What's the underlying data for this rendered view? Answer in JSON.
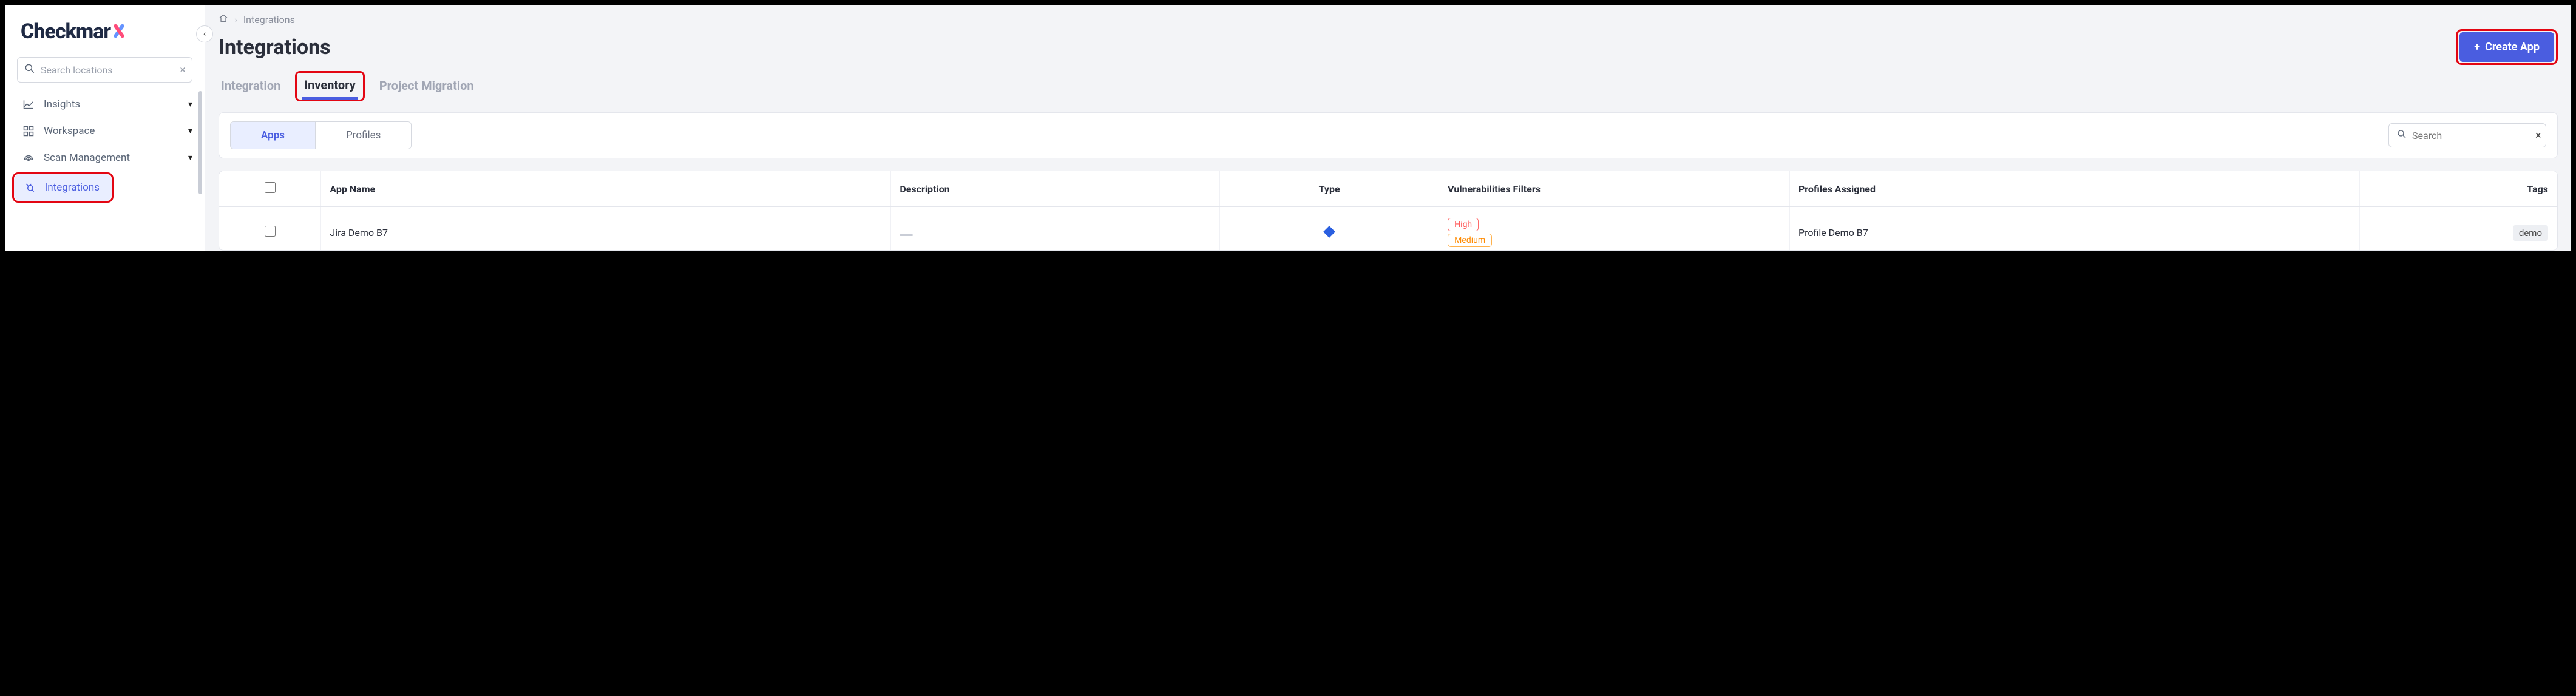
{
  "brand": {
    "name": "Checkmar"
  },
  "sidebar": {
    "search_placeholder": "Search locations",
    "items": [
      {
        "label": "Insights",
        "icon": "chart-line-icon",
        "expandable": true
      },
      {
        "label": "Workspace",
        "icon": "grid-icon",
        "expandable": true
      },
      {
        "label": "Scan Management",
        "icon": "radar-icon",
        "expandable": true
      },
      {
        "label": "Integrations",
        "icon": "plug-icon",
        "expandable": false,
        "active": true
      }
    ]
  },
  "breadcrumb": {
    "current": "Integrations"
  },
  "page": {
    "title": "Integrations",
    "create_label": "Create App"
  },
  "tabs": [
    {
      "label": "Integration",
      "active": false
    },
    {
      "label": "Inventory",
      "active": true
    },
    {
      "label": "Project Migration",
      "active": false
    }
  ],
  "subtabs": [
    {
      "label": "Apps",
      "active": true
    },
    {
      "label": "Profiles",
      "active": false
    }
  ],
  "panel_search_placeholder": "Search",
  "table": {
    "columns": [
      "App Name",
      "Description",
      "Type",
      "Vulnerabilities Filters",
      "Profiles Assigned",
      "Tags"
    ],
    "rows": [
      {
        "app_name": "Jira Demo B7",
        "description": "",
        "type": "jira",
        "vuln_filters": [
          "High",
          "Medium"
        ],
        "profiles": "Profile Demo B7",
        "tags": [
          "demo"
        ]
      }
    ]
  },
  "colors": {
    "accent": "#4a5de0",
    "highlight_border": "#e30613",
    "pill_high": "#ff5252",
    "pill_medium": "#ff8a00"
  }
}
